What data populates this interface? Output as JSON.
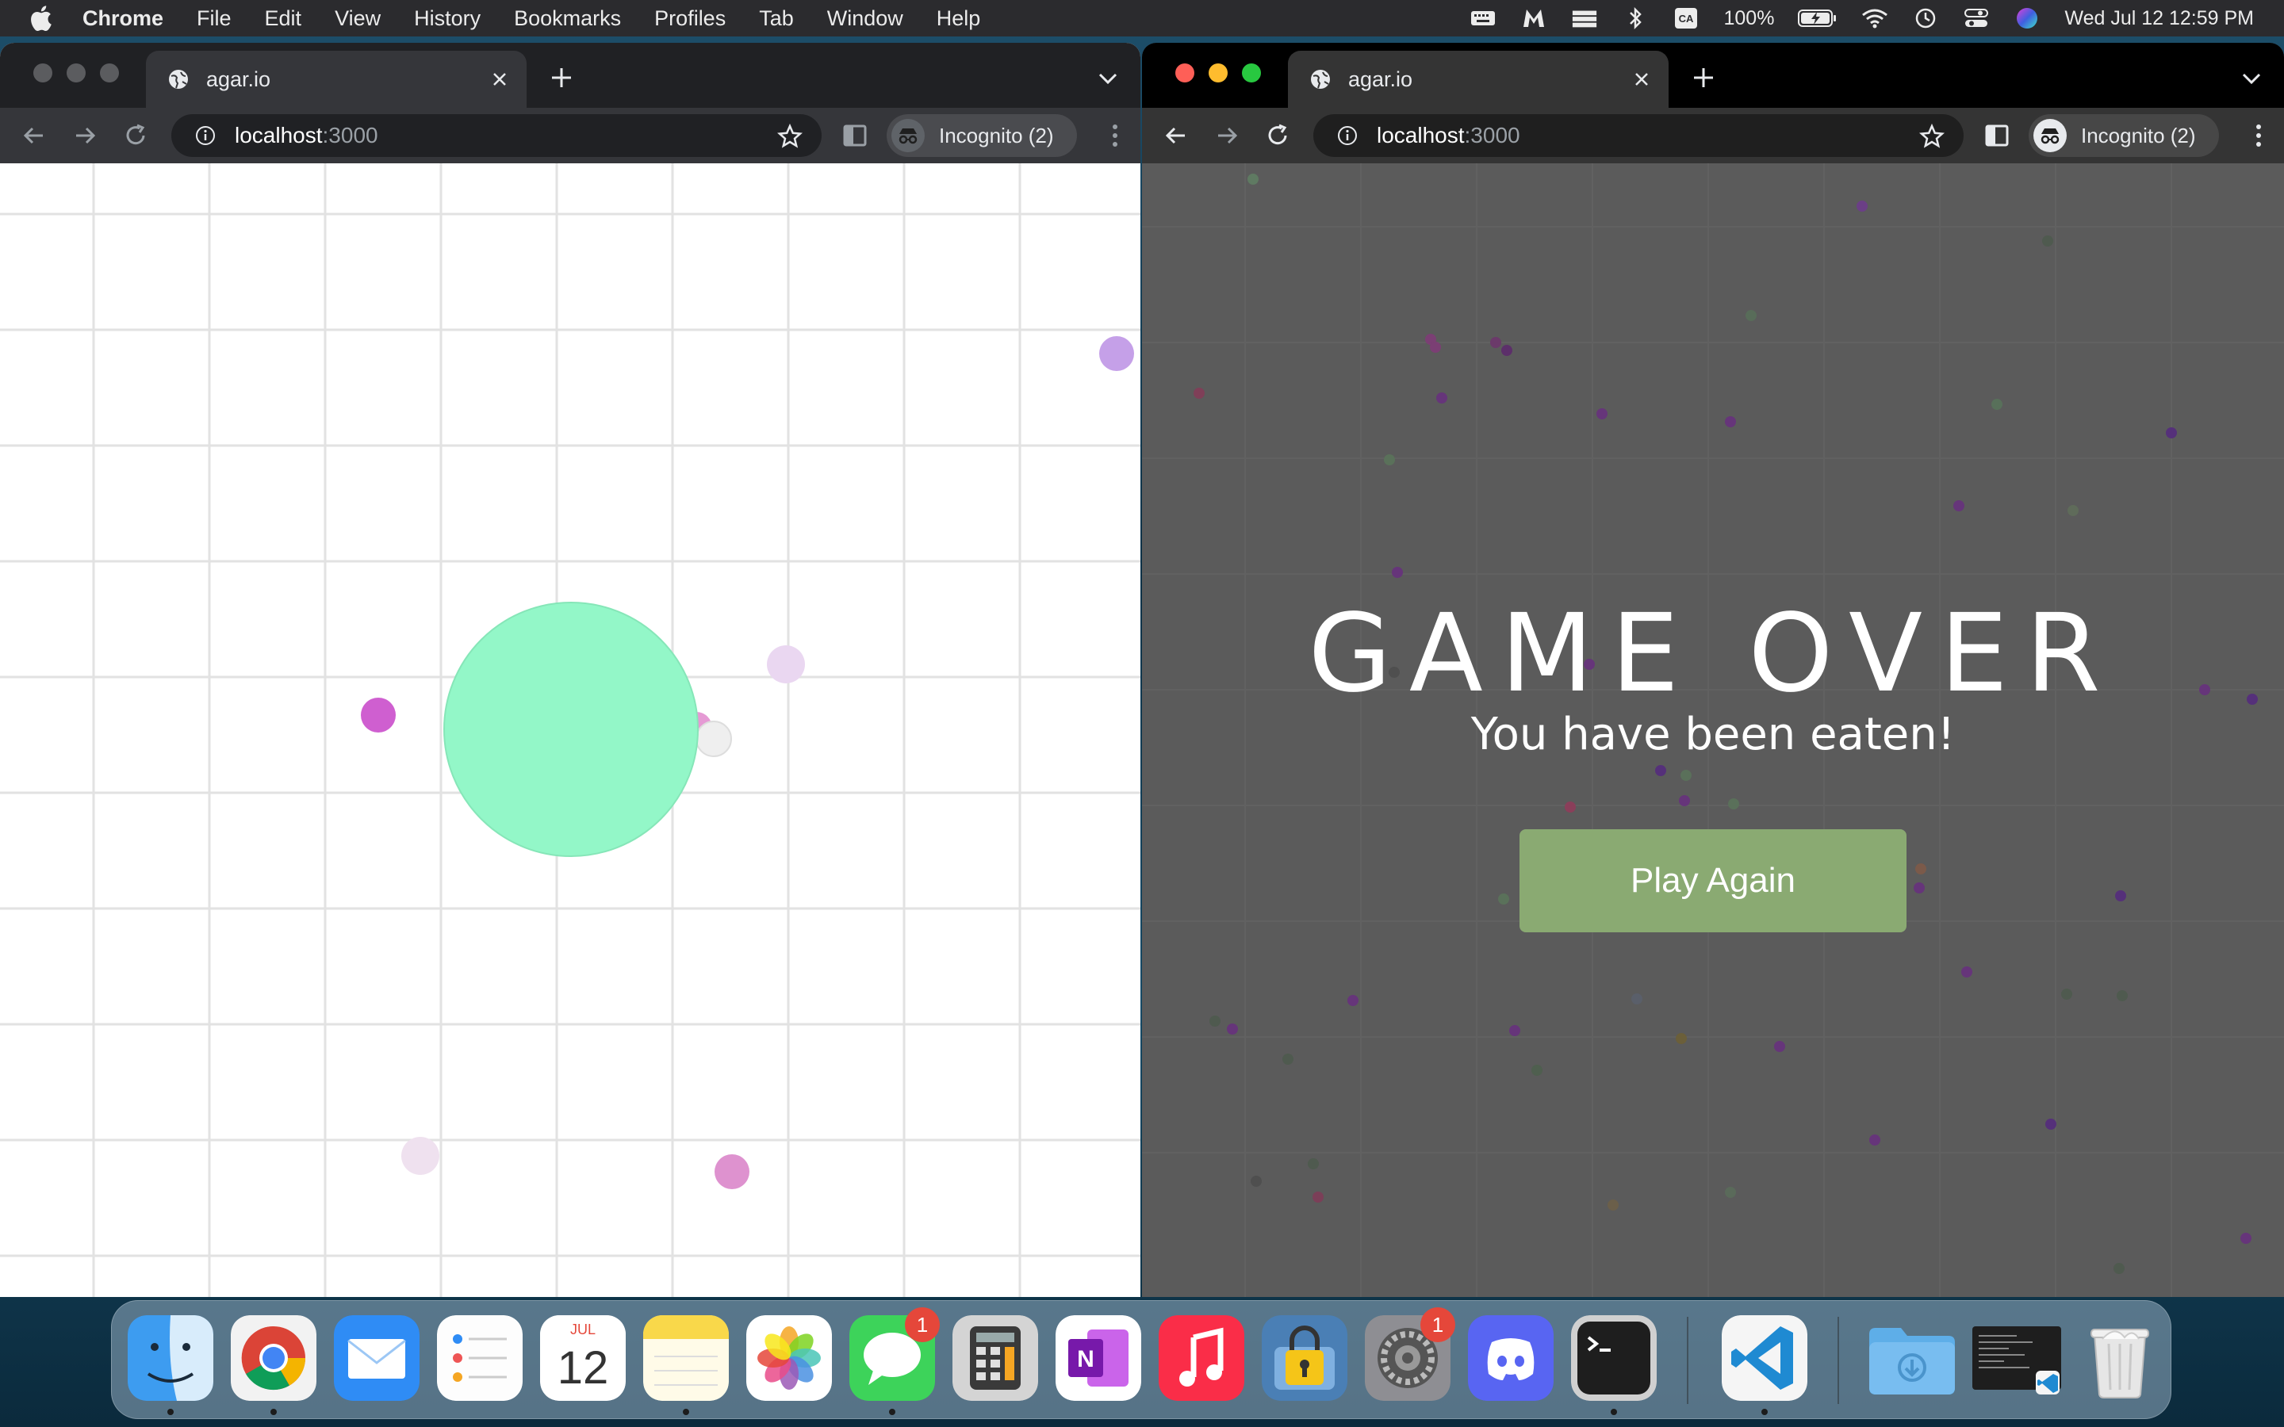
{
  "menubar": {
    "app_name": "Chrome",
    "items": [
      "File",
      "Edit",
      "View",
      "History",
      "Bookmarks",
      "Profiles",
      "Tab",
      "Window",
      "Help"
    ],
    "battery": "100%",
    "input_source": "CA",
    "datetime": "Wed Jul 12  12:59 PM"
  },
  "left_window": {
    "tab_title": "agar.io",
    "url_host": "localhost",
    "url_port": ":3000",
    "incognito_label": "Incognito (2)",
    "game": {
      "player_color": "#93f7c8",
      "food_colors": [
        "#cf5fd0",
        "#e59ad4",
        "#ead7f1",
        "#c5a0e8"
      ]
    }
  },
  "right_window": {
    "tab_title": "agar.io",
    "url_host": "localhost",
    "url_port": ":3000",
    "incognito_label": "Incognito (2)",
    "game_over": {
      "title": "GAME OVER",
      "subtitle": "You have been eaten!",
      "button": "Play Again",
      "button_color": "#8aaa72",
      "background": "#5b5b5b"
    }
  },
  "dock": {
    "apps": [
      {
        "name": "Finder",
        "icon": "finder-icon"
      },
      {
        "name": "Google Chrome",
        "icon": "chrome-icon"
      },
      {
        "name": "Mail",
        "icon": "mail-icon"
      },
      {
        "name": "Reminders",
        "icon": "reminders-icon"
      },
      {
        "name": "Calendar",
        "icon": "calendar-icon",
        "month": "JUL",
        "day": "12"
      },
      {
        "name": "Notes",
        "icon": "notes-icon"
      },
      {
        "name": "Photos",
        "icon": "photos-icon"
      },
      {
        "name": "Messages",
        "icon": "messages-icon",
        "badge": "1"
      },
      {
        "name": "Calculator",
        "icon": "calculator-icon"
      },
      {
        "name": "OneNote",
        "icon": "onenote-icon"
      },
      {
        "name": "Music",
        "icon": "music-icon"
      },
      {
        "name": "Keychain",
        "icon": "keychain-icon"
      },
      {
        "name": "System Settings",
        "icon": "settings-icon",
        "badge": "1"
      },
      {
        "name": "Discord",
        "icon": "discord-icon"
      },
      {
        "name": "Terminal",
        "icon": "terminal-icon"
      },
      {
        "name": "Visual Studio Code",
        "icon": "vscode-icon"
      },
      {
        "name": "Downloads",
        "icon": "downloads-folder-icon"
      },
      {
        "name": "Recent",
        "icon": "recent-window-icon"
      },
      {
        "name": "Trash",
        "icon": "trash-icon"
      }
    ]
  }
}
